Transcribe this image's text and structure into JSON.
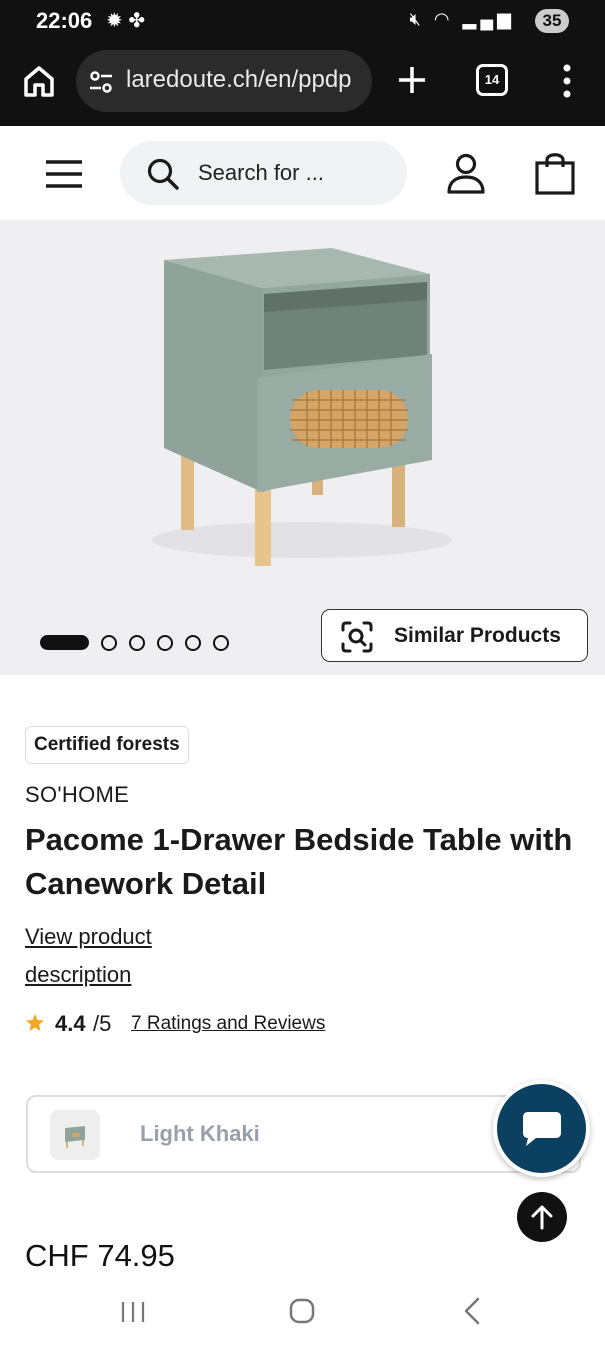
{
  "status_bar": {
    "time": "22:06",
    "left_icons": [
      "weather-icon",
      "fan-icon"
    ],
    "right_icons": [
      "mute-icon",
      "wifi-icon",
      "signal-icon"
    ],
    "battery": "35"
  },
  "browser": {
    "url": "laredoute.ch/en/ppdp",
    "tab_count": "14"
  },
  "header": {
    "search_placeholder": "Search for ..."
  },
  "gallery": {
    "image_count": 6,
    "active_index": 0,
    "similar_products_label": "Similar Products"
  },
  "product": {
    "badge": "Certified forests",
    "brand": "SO'HOME",
    "title": "Pacome 1-Drawer Bedside Table with Canework Detail",
    "description_link": "View product description",
    "rating": "4.4",
    "rating_max": "/5",
    "reviews_link": "7 Ratings and Reviews",
    "color": "Light Khaki",
    "price": "CHF 74.95"
  },
  "colors": {
    "star": "#f5a623",
    "chat_button": "#0c4060",
    "muted_text": "#9aa0ab",
    "table_body": "#8fa39b"
  }
}
